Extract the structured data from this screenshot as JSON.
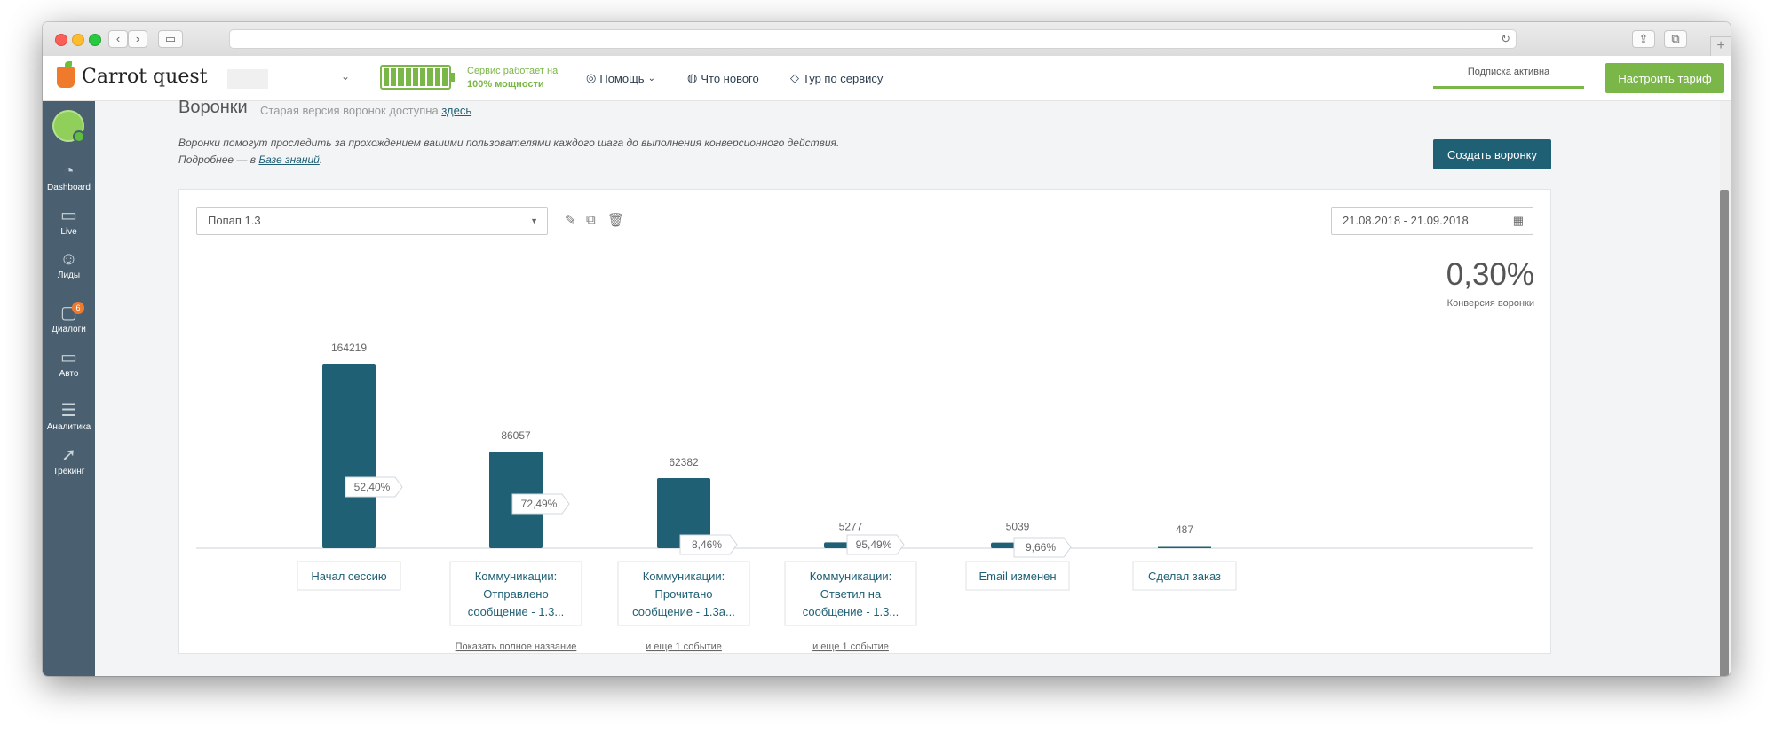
{
  "browser": {
    "reload_icon": "reload-icon",
    "new_tab": "+"
  },
  "header": {
    "logo_text": "Carrot quest",
    "service_status_line1": "Сервис работает на",
    "service_status_line2": "100% мощности",
    "nav": [
      {
        "label": "Помощь",
        "icon": "lifebuoy-icon"
      },
      {
        "label": "Что нового",
        "icon": "globe-icon"
      },
      {
        "label": "Тур по сервису",
        "icon": "graduation-cap-icon"
      }
    ],
    "subscription_status": "Подписка активна",
    "tariff_button": "Настроить тариф",
    "accent_green": "#7ab648"
  },
  "sidebar": {
    "items": [
      {
        "label": "Dashboard",
        "icon": "speedometer-icon"
      },
      {
        "label": "Live",
        "icon": "pulse-monitor-icon"
      },
      {
        "label": "Лиды",
        "icon": "users-icon"
      },
      {
        "label": "Диалоги",
        "icon": "chat-bubbles-icon",
        "badge": "6"
      },
      {
        "label": "Авто",
        "icon": "auto-message-icon"
      },
      {
        "label": "Аналитика",
        "icon": "funnel-icon"
      },
      {
        "label": "Трекинг",
        "icon": "cursor-icon"
      }
    ]
  },
  "page": {
    "title": "Воронки",
    "subtitle": "Старая версия воронок доступна",
    "subtitle_link": "здесь",
    "description_line1": "Воронки помогут проследить за прохождением вашими пользователями каждого шага до выполнения конверсионного действия.",
    "description_line2_prefix": "Подробнее — в",
    "description_link": "Базе знаний",
    "description_suffix": ".",
    "create_button": "Создать воронку"
  },
  "funnel": {
    "selected": "Попап 1.3",
    "date_range": "21.08.2018 - 21.09.2018",
    "conversion_value": "0,30%",
    "conversion_label": "Конверсия воронки",
    "bar_color": "#1f6075"
  },
  "chart_data": {
    "type": "bar",
    "categories": [
      "Начал сессию",
      "Коммуникации: Отправлено сообщение - 1.3...",
      "Коммуникации: Прочитано сообщение - 1.3а...",
      "Коммуникации: Ответил на сообщение - 1.3...",
      "Email изменен",
      "Сделал заказ"
    ],
    "label_lines": [
      [
        "Начал сессию"
      ],
      [
        "Коммуникации:",
        "Отправлено",
        "сообщение - 1.3..."
      ],
      [
        "Коммуникации:",
        "Прочитано",
        "сообщение - 1.3а..."
      ],
      [
        "Коммуникации:",
        "Ответил на",
        "сообщение - 1.3..."
      ],
      [
        "Email изменен"
      ],
      [
        "Сделал заказ"
      ]
    ],
    "values": [
      164219,
      86057,
      62382,
      5277,
      5039,
      487
    ],
    "value_labels": [
      "164219",
      "86057",
      "62382",
      "5277",
      "5039",
      "487"
    ],
    "step_conversions": [
      "52,40%",
      "72,49%",
      "8,46%",
      "95,49%",
      "9,66%"
    ],
    "footnotes": [
      "",
      "Показать полное название",
      "и еще 1 событие",
      "и еще 1 событие",
      "",
      ""
    ],
    "ylim": [
      0,
      164219
    ]
  }
}
